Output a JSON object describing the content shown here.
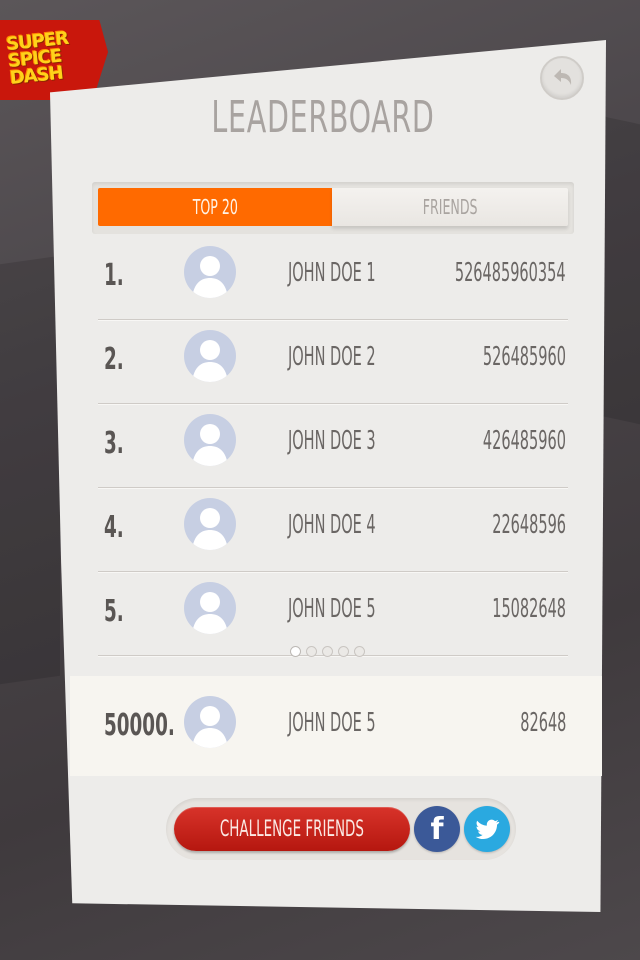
{
  "logo": {
    "line1": "SUPER",
    "line2": "SPICE",
    "line3": "DASH"
  },
  "title": "LEADERBOARD",
  "tabs": [
    {
      "label": "TOP 20",
      "active": true
    },
    {
      "label": "FRIENDS",
      "active": false
    }
  ],
  "rows": [
    {
      "rank": "1.",
      "name": "JOHN DOE 1",
      "score": "526485960354"
    },
    {
      "rank": "2.",
      "name": "JOHN DOE 2",
      "score": "526485960"
    },
    {
      "rank": "3.",
      "name": "JOHN DOE 3",
      "score": "426485960"
    },
    {
      "rank": "4.",
      "name": "JOHN DOE 4",
      "score": "22648596"
    },
    {
      "rank": "5.",
      "name": "JOHN DOE 5",
      "score": "15082648"
    }
  ],
  "pager": {
    "pages": 5,
    "current": 1
  },
  "me": {
    "rank": "50000.",
    "name": "JOHN DOE 5",
    "score": "82648"
  },
  "challenge_label": "CHALLENGE FRIENDS",
  "colors": {
    "accent": "#ff6a00",
    "challenge": "#c62219",
    "facebook": "#3b5998",
    "twitter": "#2aa9e0",
    "avatar": "#c7cfe3"
  },
  "icons": {
    "back": "back-arrow-icon",
    "avatar": "user-silhouette-icon",
    "facebook": "facebook-icon",
    "twitter": "twitter-icon"
  }
}
